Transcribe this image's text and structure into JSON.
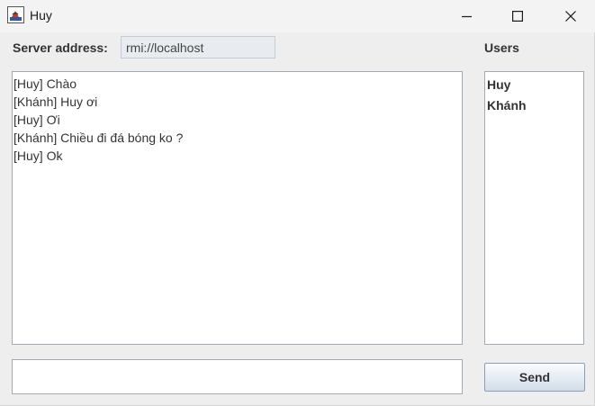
{
  "window": {
    "title": "Huy",
    "icon": "java-app-icon",
    "controls": [
      "minimize-icon",
      "maximize-icon",
      "close-icon"
    ]
  },
  "server": {
    "label": "Server address:",
    "value": "rmi://localhost"
  },
  "users": {
    "label": "Users",
    "items": [
      "Huy",
      "Khánh"
    ]
  },
  "chat": {
    "messages": [
      "[Huy] Chào",
      "[Khánh] Huy ơi",
      "[Huy] Ơi",
      "[Khánh] Chiều đi đá bóng ko ?",
      "[Huy] Ok"
    ]
  },
  "input": {
    "value": ""
  },
  "send": {
    "label": "Send"
  }
}
